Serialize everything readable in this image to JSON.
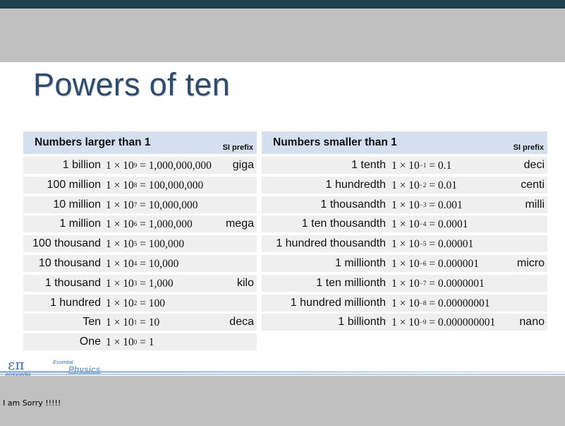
{
  "slide": {
    "title": "Powers of ten",
    "footer": {
      "logo_symbol": "επ",
      "logo_text": "ergopedia",
      "brand_small": "Essential",
      "brand_name": "Physics"
    }
  },
  "caption": "I am Sorry !!!!!",
  "larger": {
    "heading": "Numbers larger than 1",
    "si_heading": "SI prefix",
    "rows": [
      {
        "name": "1 billion",
        "exp": "9",
        "value": "1,000,000,000",
        "prefix": "giga"
      },
      {
        "name": "100 million",
        "exp": "8",
        "value": "100,000,000",
        "prefix": ""
      },
      {
        "name": "10 million",
        "exp": "7",
        "value": "10,000,000",
        "prefix": ""
      },
      {
        "name": "1 million",
        "exp": "6",
        "value": "1,000,000",
        "prefix": "mega"
      },
      {
        "name": "100 thousand",
        "exp": "5",
        "value": "100,000",
        "prefix": ""
      },
      {
        "name": "10 thousand",
        "exp": "4",
        "value": "10,000",
        "prefix": ""
      },
      {
        "name": "1 thousand",
        "exp": "3",
        "value": "1,000",
        "prefix": "kilo"
      },
      {
        "name": "1 hundred",
        "exp": "2",
        "value": "100",
        "prefix": ""
      },
      {
        "name": "Ten",
        "exp": "1",
        "value": "10",
        "prefix": "deca"
      },
      {
        "name": "One",
        "exp": "0",
        "value": "1",
        "prefix": ""
      }
    ]
  },
  "smaller": {
    "heading": "Numbers smaller than 1",
    "si_heading": "SI prefix",
    "rows": [
      {
        "name": "1 tenth",
        "exp": "−1",
        "value": "0.1",
        "prefix": "deci"
      },
      {
        "name": "1 hundredth",
        "exp": "−2",
        "value": "0.01",
        "prefix": "centi"
      },
      {
        "name": "1 thousandth",
        "exp": "−3",
        "value": "0.001",
        "prefix": "milli"
      },
      {
        "name": "1 ten thousandth",
        "exp": "−4",
        "value": "0.0001",
        "prefix": ""
      },
      {
        "name": "1 hundred thousandth",
        "exp": "−5",
        "value": "0.00001",
        "prefix": ""
      },
      {
        "name": "1 millionth",
        "exp": "−6",
        "value": "0.000001",
        "prefix": "micro"
      },
      {
        "name": "1 ten millionth",
        "exp": "−7",
        "value": "0.0000001",
        "prefix": ""
      },
      {
        "name": "1 hundred millionth",
        "exp": "−8",
        "value": "0.00000001",
        "prefix": ""
      },
      {
        "name": "1 billionth",
        "exp": "−9",
        "value": "0.000000001",
        "prefix": "nano"
      }
    ]
  },
  "colors": {
    "title": "#2e4b6b",
    "header_bg": "#d4dff0",
    "row_bg": "#efefef",
    "top_bar": "#1f3f4d"
  }
}
